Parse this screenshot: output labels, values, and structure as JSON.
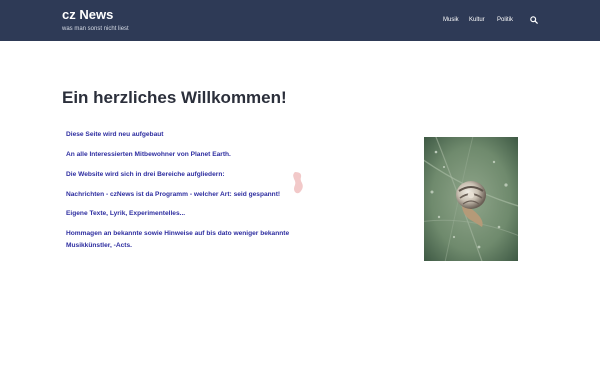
{
  "header": {
    "title": "cz News",
    "tagline": "was man sonst nicht liest",
    "nav": [
      "Musik",
      "Kultur",
      "Politik"
    ],
    "search_icon": "search-icon"
  },
  "main": {
    "heading": "Ein herzliches Willkommen!",
    "lines": [
      "Diese Seite wird neu aufgebaut",
      "An alle Interessierten Mitbewohner von Planet Earth.",
      "Die Website wird sich in drei Bereiche aufgliedern:",
      "Nachrichten - czNews ist da Programm - welcher Art: seid gespannt!",
      "Eigene Texte, Lyrik, Experimentelles...",
      "Hommagen an bekannte sowie Hinweise auf bis dato weniger bekannte",
      "Musikkünstler, -Acts."
    ]
  },
  "colors": {
    "header_bg": "#2e3a56",
    "text_link": "#2e2ea0",
    "heading": "#2b2f3b"
  }
}
